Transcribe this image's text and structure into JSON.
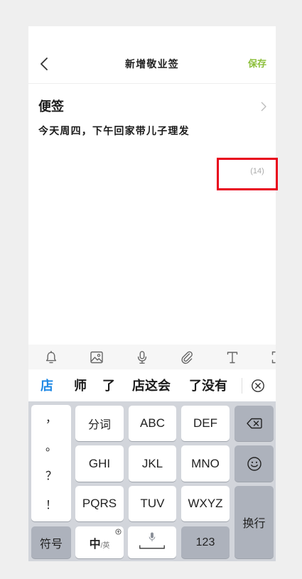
{
  "header": {
    "back_icon": "chevron-left-icon",
    "title": "新增敬业签",
    "save_label": "保存"
  },
  "note": {
    "heading": "便签",
    "heading_icon": "chevron-right-icon",
    "content": "今天周四，下午回家带儿子理发",
    "char_count": "(14)"
  },
  "toolbar": {
    "icons": [
      "bell-icon",
      "image-icon",
      "microphone-icon",
      "paperclip-icon",
      "text-format-icon",
      "expand-icon"
    ]
  },
  "candidates": {
    "items": [
      "店",
      "师",
      "了",
      "店这会",
      "了没有"
    ],
    "close_icon": "close-circle-icon"
  },
  "keyboard": {
    "punctuation": [
      "，",
      "。",
      "？",
      "！"
    ],
    "rows": [
      [
        "分词",
        "ABC",
        "DEF"
      ],
      [
        "GHI",
        "JKL",
        "MNO"
      ],
      [
        "PQRS",
        "TUV",
        "WXYZ"
      ]
    ],
    "delete_icon": "backspace-icon",
    "emoji_icon": "emoji-icon",
    "enter_label": "换行",
    "symbols_label": "符号",
    "lang_main": "中",
    "lang_alt": "/英",
    "lang_icon": "input-mode-icon",
    "space_icon": "microphone-icon",
    "numbers_label": "123"
  },
  "colors": {
    "accent_green": "#8cbf3a",
    "candidate_highlight": "#1e88e5",
    "highlight_box": "#e8001c",
    "keyboard_bg": "#d2d5db",
    "function_key": "#adb2bc"
  }
}
